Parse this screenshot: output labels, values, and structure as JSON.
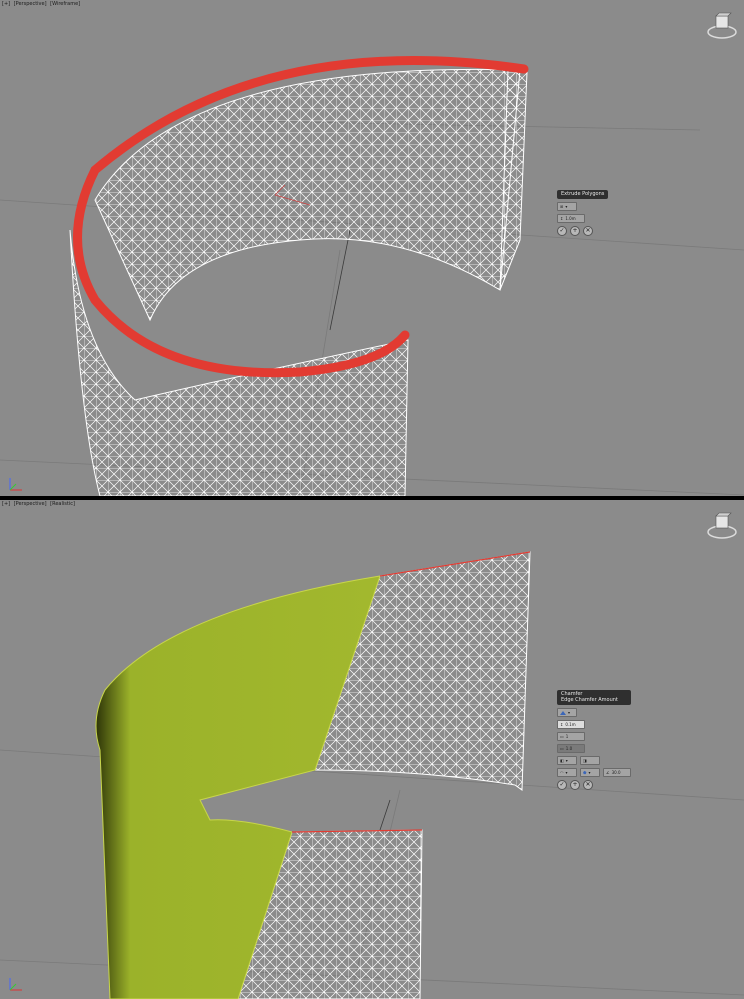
{
  "top_viewport": {
    "label": [
      "[+]",
      "[Perspective]",
      "[Wireframe]"
    ],
    "caddy": {
      "title": "Extrude Polygons",
      "field_value": "1.0m"
    },
    "caddy_buttons": {
      "ok": "✓",
      "apply": "+",
      "cancel": "✕"
    }
  },
  "bottom_viewport": {
    "label": [
      "[+]",
      "[Perspective]",
      "[Realistic]"
    ],
    "caddy": {
      "title": "Chamfer",
      "tooltip": "Edge Chamfer Amount",
      "amount_value": "0.1m",
      "segments_value": "1",
      "tension_value": "1.0",
      "angle_value": "30.0"
    },
    "caddy_buttons": {
      "ok": "✓",
      "apply": "+",
      "cancel": "✕"
    }
  },
  "colors": {
    "viewport_bg": "#8b8b8b",
    "selection_red": "#e23b32",
    "chamfer_yellow": "#9bb22a",
    "wire_white": "#ffffff"
  },
  "icons": [
    "viewcube-icon",
    "axis-tripod-icon",
    "chevron-down-icon",
    "check-icon",
    "plus-icon",
    "close-icon"
  ]
}
